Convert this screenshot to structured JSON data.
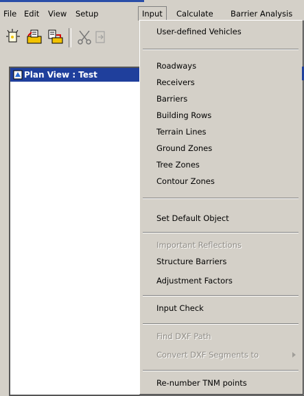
{
  "menubar": {
    "items": [
      "File",
      "Edit",
      "View",
      "Setup",
      "Input",
      "Calculate",
      "Barrier Analysis"
    ],
    "active": "Input"
  },
  "toolbar": {
    "icons": [
      "new-document-icon",
      "open-folder-icon",
      "export-icon",
      "cut-scissors-icon",
      "split-icon"
    ]
  },
  "child_window": {
    "title": "Plan View : Test"
  },
  "input_menu": {
    "groups": [
      [
        {
          "label": "User-defined Vehicles",
          "enabled": true
        }
      ],
      [
        {
          "label": "Roadways",
          "enabled": true
        },
        {
          "label": "Receivers",
          "enabled": true
        },
        {
          "label": "Barriers",
          "enabled": true
        },
        {
          "label": "Building Rows",
          "enabled": true
        },
        {
          "label": "Terrain Lines",
          "enabled": true
        },
        {
          "label": "Ground Zones",
          "enabled": true
        },
        {
          "label": "Tree Zones",
          "enabled": true
        },
        {
          "label": "Contour Zones",
          "enabled": true
        }
      ],
      [
        {
          "label": "Set Default Object",
          "enabled": true
        }
      ],
      [
        {
          "label": "Important Reflections",
          "enabled": false
        },
        {
          "label": "Structure Barriers",
          "enabled": true
        },
        {
          "label": "Adjustment Factors",
          "enabled": true
        }
      ],
      [
        {
          "label": "Input Check",
          "enabled": true
        }
      ],
      [
        {
          "label": "Find DXF Path",
          "enabled": false
        },
        {
          "label": "Convert DXF Segments to",
          "enabled": false,
          "submenu": true
        }
      ],
      [
        {
          "label": "Re-number TNM points",
          "enabled": true
        }
      ]
    ]
  }
}
